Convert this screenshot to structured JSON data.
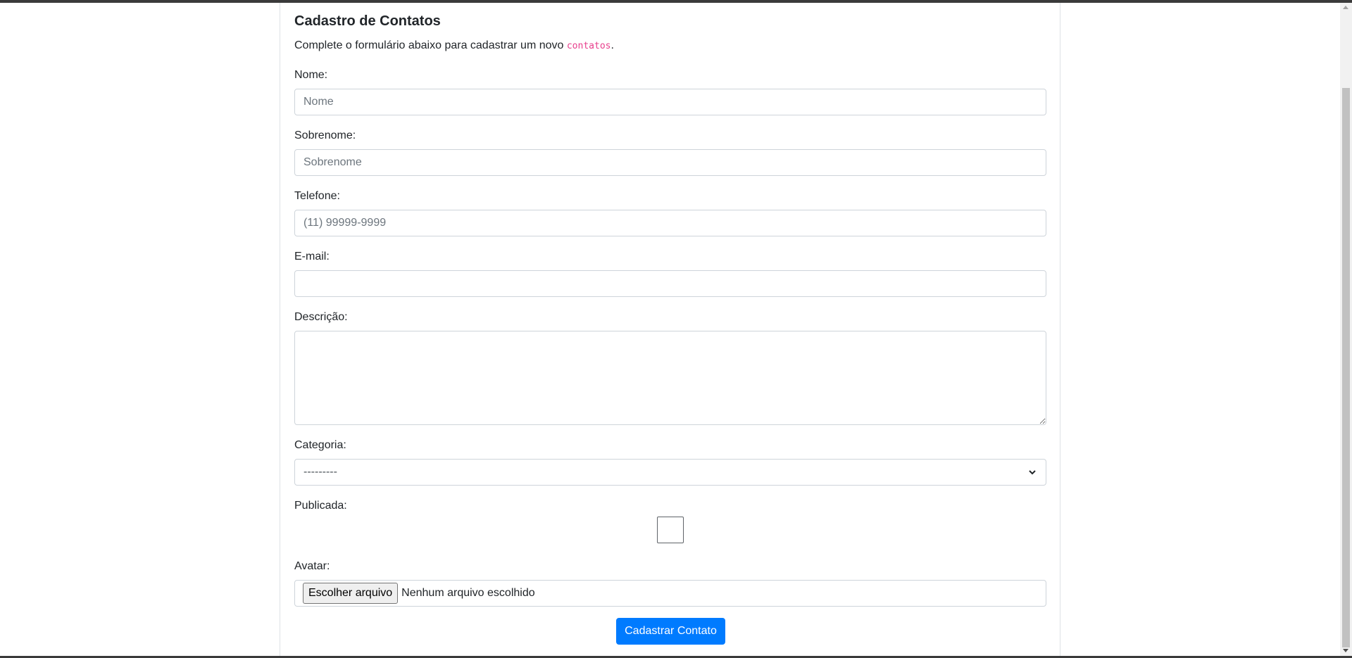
{
  "form": {
    "title": "Cadastro de Contatos",
    "intro_text": "Complete o formulário abaixo para cadastrar um novo ",
    "intro_code": "contatos",
    "intro_end": ".",
    "fields": {
      "nome": {
        "label": "Nome:",
        "placeholder": "Nome",
        "value": ""
      },
      "sobrenome": {
        "label": "Sobrenome:",
        "placeholder": "Sobrenome",
        "value": ""
      },
      "telefone": {
        "label": "Telefone:",
        "placeholder": "(11) 99999-9999",
        "value": ""
      },
      "email": {
        "label": "E-mail:",
        "placeholder": "",
        "value": ""
      },
      "descricao": {
        "label": "Descrição:",
        "value": ""
      },
      "categoria": {
        "label": "Categoria:",
        "selected": "---------"
      },
      "publicada": {
        "label": "Publicada:",
        "checked": false
      },
      "avatar": {
        "label": "Avatar:",
        "button_label": "Escolher arquivo",
        "status": "Nenhum arquivo escolhido"
      }
    },
    "submit_label": "Cadastrar Contato"
  },
  "colors": {
    "primary": "#007bff",
    "code": "#e83e8c",
    "border": "#ced4da"
  }
}
